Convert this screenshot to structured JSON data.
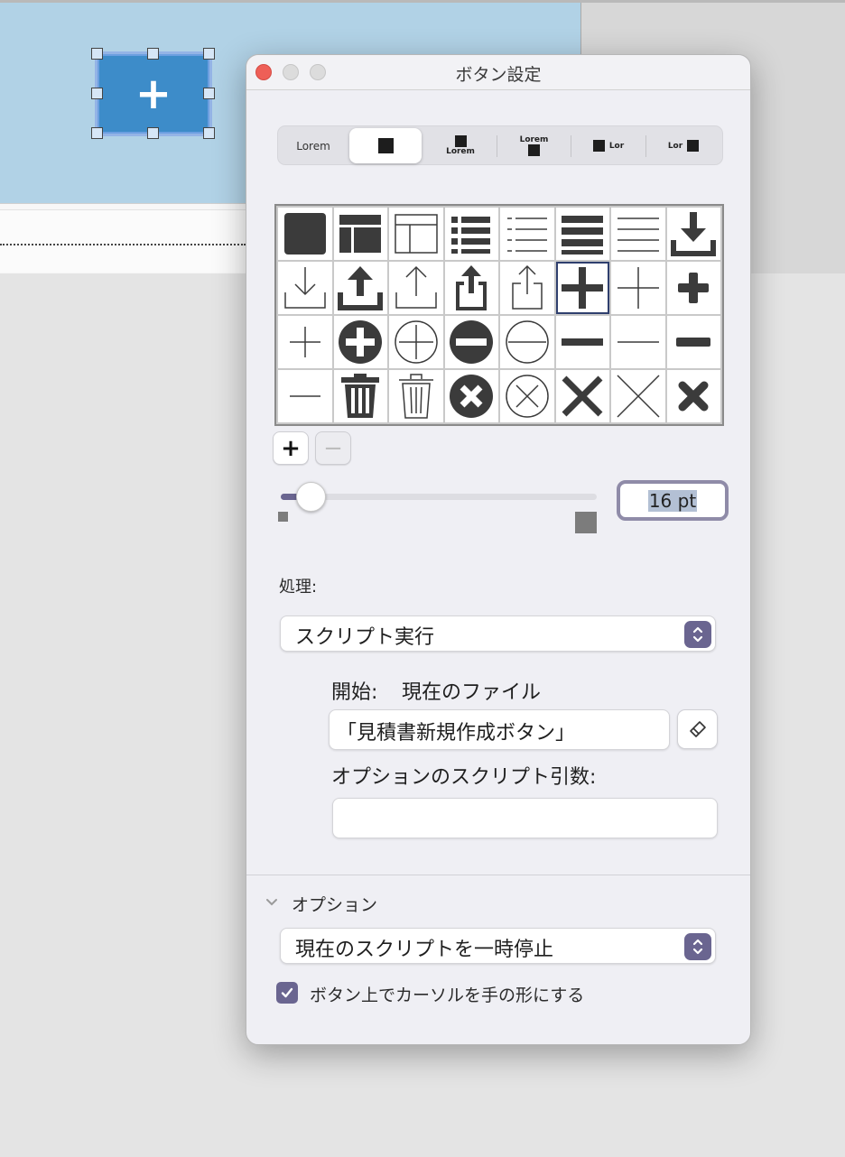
{
  "canvas": {
    "selected_button_symbol": "+"
  },
  "dialog": {
    "title": "ボタン設定",
    "style_segments": [
      {
        "label": "Lorem",
        "style": "text"
      },
      {
        "label": "",
        "style": "icon"
      },
      {
        "label": "Lorem",
        "style": "icon-above-text"
      },
      {
        "label": "Lorem",
        "style": "text-above-icon"
      },
      {
        "label": "Lor",
        "style": "icon-left-text"
      },
      {
        "label": "Lor",
        "style": "text-left-icon"
      }
    ],
    "active_segment": 1,
    "icon_grid": {
      "rows": 4,
      "columns": 8,
      "selected": "plus-bold",
      "icons": [
        "square-filled",
        "layout-sidebar-bold",
        "layout-sidebar-thin",
        "list-bullets-bold",
        "list-bullets-thin",
        "lines-bold",
        "lines-thin",
        "download-bold",
        "download-thin",
        "upload-bold",
        "upload-thin",
        "share-bold",
        "share-thin",
        "plus-bold",
        "plus-thin",
        "plus-heavy",
        "plus-light",
        "plus-circle-filled",
        "plus-circle-outline",
        "minus-circle-filled",
        "minus-circle-outline",
        "minus-bold",
        "minus-thin",
        "minus-heavy",
        "minus-light",
        "trash-bold",
        "trash-thin",
        "x-circle-filled",
        "x-circle-outline",
        "x-bold",
        "x-thin",
        "x-heavy"
      ]
    },
    "add_button": "+",
    "remove_button": "−",
    "size": {
      "value_text": "16 pt",
      "slider_fraction": 0.1
    },
    "action_label": "処理:",
    "action_value": "スクリプト実行",
    "start_label": "開始:",
    "start_value": "現在のファイル",
    "script_name": "「見積書新規作成ボタン」",
    "param_label": "オプションのスクリプト引数:",
    "param_value": "",
    "options_header": "オプション",
    "options_select_value": "現在のスクリプトを一時停止",
    "hand_cursor_label": "ボタン上でカーソルを手の形にする",
    "hand_cursor_checked": true
  },
  "colors": {
    "accent": "#6a6590",
    "canvas_blue": "#b1d2e6",
    "button_blue": "#3d8cc9",
    "close_red": "#ee5f57"
  }
}
